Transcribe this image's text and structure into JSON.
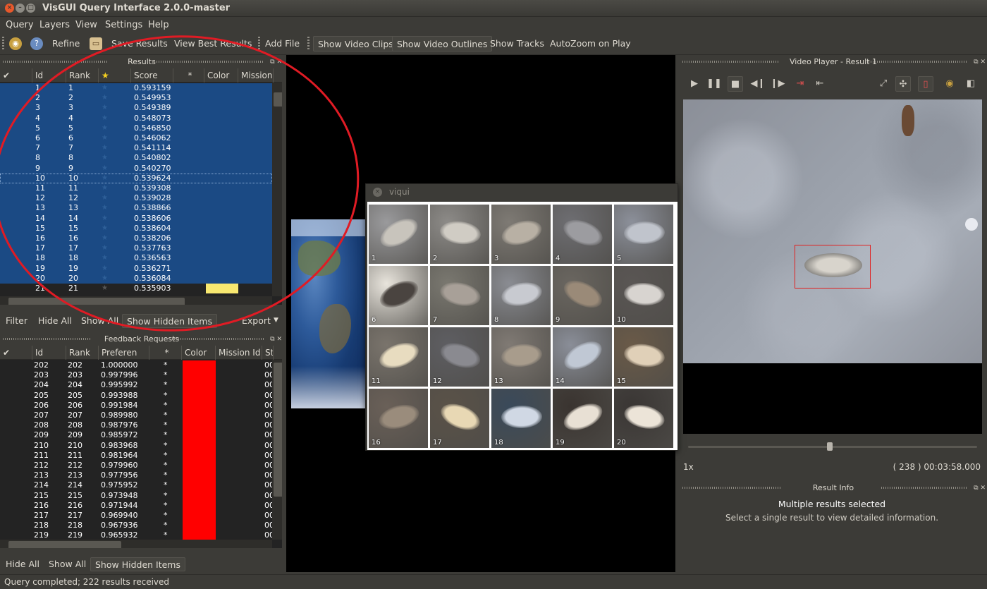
{
  "window": {
    "title": "VisGUI Query Interface 2.0.0-master"
  },
  "menu": [
    "Query",
    "Layers",
    "View",
    "Settings",
    "Help"
  ],
  "toolbar": {
    "refine": "Refine",
    "save_results": "Save Results",
    "view_best": "View Best Results",
    "add_file": "Add File",
    "show_video_clips": "Show Video Clips",
    "show_video_outlines": "Show Video Outlines",
    "show_tracks": "Show Tracks",
    "autozoom": "AutoZoom on Play"
  },
  "results": {
    "title": "Results",
    "columns": [
      "Id",
      "Rank",
      "★",
      "Score",
      "*",
      "Color",
      "Mission"
    ],
    "rows": [
      {
        "id": "1",
        "rank": "1",
        "score": "0.593159"
      },
      {
        "id": "2",
        "rank": "2",
        "score": "0.549953"
      },
      {
        "id": "3",
        "rank": "3",
        "score": "0.549389"
      },
      {
        "id": "4",
        "rank": "4",
        "score": "0.548073"
      },
      {
        "id": "5",
        "rank": "5",
        "score": "0.546850"
      },
      {
        "id": "6",
        "rank": "6",
        "score": "0.546062"
      },
      {
        "id": "7",
        "rank": "7",
        "score": "0.541114"
      },
      {
        "id": "8",
        "rank": "8",
        "score": "0.540802"
      },
      {
        "id": "9",
        "rank": "9",
        "score": "0.540270"
      },
      {
        "id": "10",
        "rank": "10",
        "score": "0.539624"
      },
      {
        "id": "11",
        "rank": "11",
        "score": "0.539308"
      },
      {
        "id": "12",
        "rank": "12",
        "score": "0.539028"
      },
      {
        "id": "13",
        "rank": "13",
        "score": "0.538866"
      },
      {
        "id": "14",
        "rank": "14",
        "score": "0.538606"
      },
      {
        "id": "15",
        "rank": "15",
        "score": "0.538604"
      },
      {
        "id": "16",
        "rank": "16",
        "score": "0.538206"
      },
      {
        "id": "17",
        "rank": "17",
        "score": "0.537763"
      },
      {
        "id": "18",
        "rank": "18",
        "score": "0.536563"
      },
      {
        "id": "19",
        "rank": "19",
        "score": "0.536271"
      },
      {
        "id": "20",
        "rank": "20",
        "score": "0.536084"
      },
      {
        "id": "21",
        "rank": "21",
        "score": "0.535903"
      }
    ],
    "selected_count": 20,
    "focus_row": 9,
    "highlight_color": "#f8e870"
  },
  "filter_bar": {
    "filter": "Filter",
    "hide_all": "Hide All",
    "show_all": "Show All",
    "show_hidden": "Show Hidden Items",
    "export": "Export"
  },
  "feedback": {
    "title": "Feedback Requests",
    "columns": [
      "Id",
      "Rank",
      "Preferen",
      "*",
      "Color",
      "Mission Id",
      "St"
    ],
    "rows": [
      {
        "id": "202",
        "rank": "202",
        "pref": "1.000000",
        "star": "*",
        "st": "00"
      },
      {
        "id": "203",
        "rank": "203",
        "pref": "0.997996",
        "star": "*",
        "st": "00"
      },
      {
        "id": "204",
        "rank": "204",
        "pref": "0.995992",
        "star": "*",
        "st": "00"
      },
      {
        "id": "205",
        "rank": "205",
        "pref": "0.993988",
        "star": "*",
        "st": "00"
      },
      {
        "id": "206",
        "rank": "206",
        "pref": "0.991984",
        "star": "*",
        "st": "00"
      },
      {
        "id": "207",
        "rank": "207",
        "pref": "0.989980",
        "star": "*",
        "st": "00"
      },
      {
        "id": "208",
        "rank": "208",
        "pref": "0.987976",
        "star": "*",
        "st": "00"
      },
      {
        "id": "209",
        "rank": "209",
        "pref": "0.985972",
        "star": "*",
        "st": "00"
      },
      {
        "id": "210",
        "rank": "210",
        "pref": "0.983968",
        "star": "*",
        "st": "00"
      },
      {
        "id": "211",
        "rank": "211",
        "pref": "0.981964",
        "star": "*",
        "st": "00"
      },
      {
        "id": "212",
        "rank": "212",
        "pref": "0.979960",
        "star": "*",
        "st": "00"
      },
      {
        "id": "213",
        "rank": "213",
        "pref": "0.977956",
        "star": "*",
        "st": "00"
      },
      {
        "id": "214",
        "rank": "214",
        "pref": "0.975952",
        "star": "*",
        "st": "00"
      },
      {
        "id": "215",
        "rank": "215",
        "pref": "0.973948",
        "star": "*",
        "st": "00"
      },
      {
        "id": "216",
        "rank": "216",
        "pref": "0.971944",
        "star": "*",
        "st": "00"
      },
      {
        "id": "217",
        "rank": "217",
        "pref": "0.969940",
        "star": "*",
        "st": "00"
      },
      {
        "id": "218",
        "rank": "218",
        "pref": "0.967936",
        "star": "*",
        "st": "00"
      },
      {
        "id": "219",
        "rank": "219",
        "pref": "0.965932",
        "star": "*",
        "st": "00"
      }
    ],
    "color": "#ff0000"
  },
  "bottom_bar": {
    "hide_all": "Hide All",
    "show_all": "Show All",
    "show_hidden": "Show Hidden Items"
  },
  "viqui": {
    "title": "viqui",
    "thumbnails": [
      "1",
      "2",
      "3",
      "4",
      "5",
      "6",
      "7",
      "8",
      "9",
      "10",
      "11",
      "12",
      "13",
      "14",
      "15",
      "16",
      "17",
      "18",
      "19",
      "20"
    ]
  },
  "video_player": {
    "title": "Video Player - Result 1",
    "speed": "1x",
    "time": "( 238 ) 00:03:58.000",
    "position_fraction": 0.49
  },
  "result_info": {
    "title": "Result Info",
    "main": "Multiple results selected",
    "sub": "Select a single result to view detailed information."
  },
  "status": "Query completed; 222 results received"
}
